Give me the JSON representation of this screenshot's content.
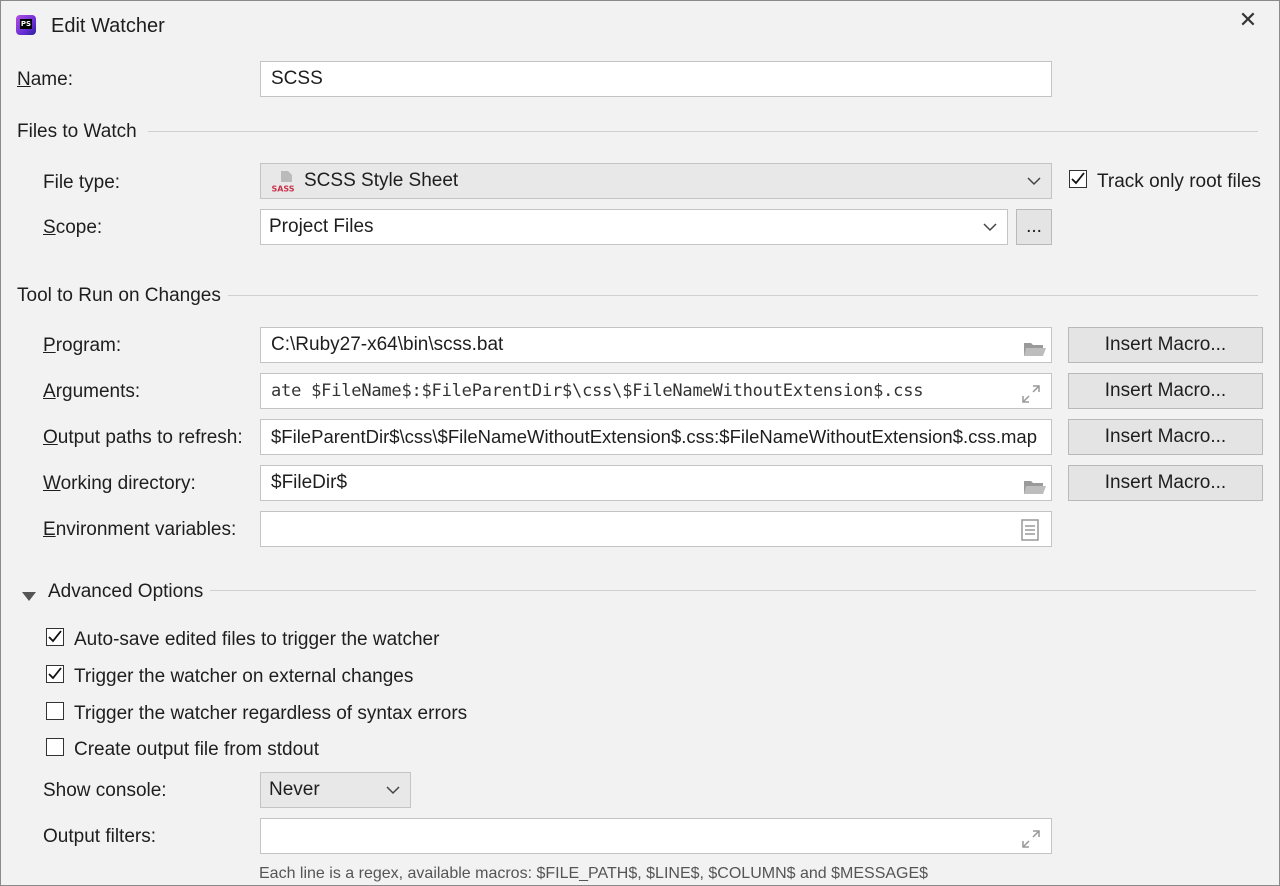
{
  "window": {
    "title": "Edit Watcher",
    "app_icon_text": "PS"
  },
  "name": {
    "label": "Name:",
    "value": "SCSS"
  },
  "files_to_watch": {
    "heading": "Files to Watch",
    "file_type_label": "File type:",
    "file_type_value": "SCSS Style Sheet",
    "file_type_icon_text": "SASS",
    "track_only_root": {
      "label": "Track only root files",
      "checked": true
    },
    "scope_label": "Scope:",
    "scope_value": "Project Files",
    "scope_button": "..."
  },
  "tool": {
    "heading": "Tool to Run on Changes",
    "program_label": "Program:",
    "program_value": "C:\\Ruby27-x64\\bin\\scss.bat",
    "arguments_label": "Arguments:",
    "arguments_value": "ate $FileName$:$FileParentDir$\\css\\$FileNameWithoutExtension$.css",
    "output_paths_label": "Output paths to refresh:",
    "output_paths_value": "$FileParentDir$\\css\\$FileNameWithoutExtension$.css:$FileNameWithoutExtension$.css.map",
    "working_dir_label": "Working directory:",
    "working_dir_value": "$FileDir$",
    "env_label": "Environment variables:",
    "env_value": "",
    "insert_macro": "Insert Macro..."
  },
  "advanced": {
    "heading": "Advanced Options",
    "options": [
      {
        "label": "Auto-save edited files to trigger the watcher",
        "checked": true
      },
      {
        "label": "Trigger the watcher on external changes",
        "checked": true
      },
      {
        "label": "Trigger the watcher regardless of syntax errors",
        "checked": false
      },
      {
        "label": "Create output file from stdout",
        "checked": false
      }
    ],
    "show_console_label": "Show console:",
    "show_console_value": "Never",
    "output_filters_label": "Output filters:",
    "output_filters_value": "",
    "hint": "Each line is a regex, available macros: $FILE_PATH$, $LINE$, $COLUMN$ and $MESSAGE$"
  }
}
